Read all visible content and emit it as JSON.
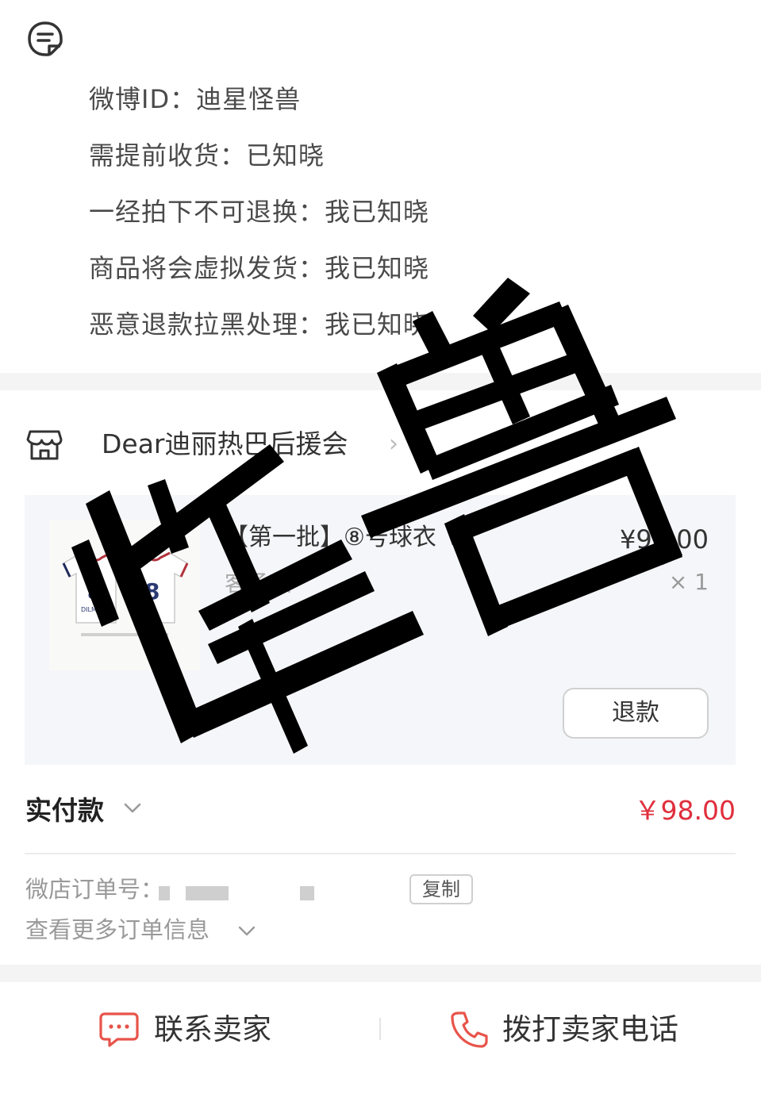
{
  "remark": {
    "icon": "note-icon",
    "lines": [
      "微博ID：迪星怪兽",
      "需提前收货：已知晓",
      "一经拍下不可退换：我已知晓",
      "商品将会虚拟发货：我已知晓",
      "恶意退款拉黑处理：我已知晓"
    ]
  },
  "shop": {
    "icon": "store-icon",
    "name": "Dear迪丽热巴后援会",
    "arrow": "›"
  },
  "item": {
    "title": "【第一批】⑧号球衣",
    "spec": "客场款",
    "price": "¥98.00",
    "qty": "× 1",
    "refund_label": "退款"
  },
  "payment": {
    "label": "实付款",
    "amount": "￥98.00",
    "accent": "#e02e3c"
  },
  "order": {
    "number_label": "微店订单号：",
    "copy_label": "复制",
    "more_label": "查看更多订单信息"
  },
  "actions": {
    "contact_label": "联系卖家",
    "call_label": "拨打卖家电话",
    "icon_color": "#e8544a"
  },
  "watermark": {
    "text": "怪兽"
  }
}
